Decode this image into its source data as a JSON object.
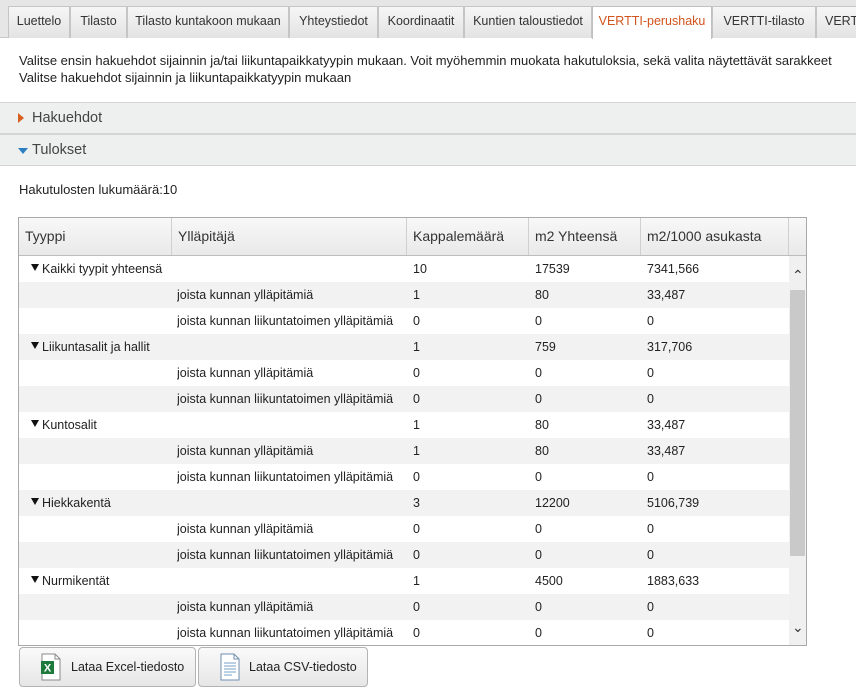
{
  "tabs": [
    {
      "label": "Luettelo",
      "active": false
    },
    {
      "label": "Tilasto",
      "active": false
    },
    {
      "label": "Tilasto kuntakoon mukaan",
      "active": false
    },
    {
      "label": "Yhteystiedot",
      "active": false
    },
    {
      "label": "Koordinaatit",
      "active": false
    },
    {
      "label": "Kuntien taloustiedot",
      "active": false
    },
    {
      "label": "VERTTI-perushaku",
      "active": true
    },
    {
      "label": "VERTTI-tilasto",
      "active": false
    },
    {
      "label": "VERT",
      "active": false
    }
  ],
  "intro": {
    "line1": "Valitse ensin hakuehdot sijainnin ja/tai liikuntapaikkatyypin mukaan. Voit myöhemmin muokata hakutuloksia, sekä valita näytettävät sarakkeet",
    "line2": "Valitse hakuehdot sijainnin ja liikuntapaikkatyypin mukaan"
  },
  "sections": {
    "search": "Hakuehdot",
    "results": "Tulokset"
  },
  "result_count": "Hakutulosten lukumäärä:10",
  "grid": {
    "columns": [
      "Tyyppi",
      "Ylläpitäjä",
      "Kappalemäärä",
      "m2 Yhteensä",
      "m2/1000 asukasta"
    ],
    "rows": [
      {
        "type": "Kaikki tyypit yhteensä",
        "maintainer": "",
        "count": "10",
        "m2": "17539",
        "per1000": "7341,566"
      },
      {
        "type": "",
        "maintainer": "joista kunnan ylläpitämiä",
        "count": "1",
        "m2": "80",
        "per1000": "33,487"
      },
      {
        "type": "",
        "maintainer": "joista kunnan liikuntatoimen ylläpitämiä",
        "count": "0",
        "m2": "0",
        "per1000": "0"
      },
      {
        "type": "Liikuntasalit ja hallit",
        "maintainer": "",
        "count": "1",
        "m2": "759",
        "per1000": "317,706"
      },
      {
        "type": "",
        "maintainer": "joista kunnan ylläpitämiä",
        "count": "0",
        "m2": "0",
        "per1000": "0"
      },
      {
        "type": "",
        "maintainer": "joista kunnan liikuntatoimen ylläpitämiä",
        "count": "0",
        "m2": "0",
        "per1000": "0"
      },
      {
        "type": "Kuntosalit",
        "maintainer": "",
        "count": "1",
        "m2": "80",
        "per1000": "33,487"
      },
      {
        "type": "",
        "maintainer": "joista kunnan ylläpitämiä",
        "count": "1",
        "m2": "80",
        "per1000": "33,487"
      },
      {
        "type": "",
        "maintainer": "joista kunnan liikuntatoimen ylläpitämiä",
        "count": "0",
        "m2": "0",
        "per1000": "0"
      },
      {
        "type": "Hiekkakentä",
        "maintainer": "",
        "count": "3",
        "m2": "12200",
        "per1000": "5106,739"
      },
      {
        "type": "",
        "maintainer": "joista kunnan ylläpitämiä",
        "count": "0",
        "m2": "0",
        "per1000": "0"
      },
      {
        "type": "",
        "maintainer": "joista kunnan liikuntatoimen ylläpitämiä",
        "count": "0",
        "m2": "0",
        "per1000": "0"
      },
      {
        "type": "Nurmikentät",
        "maintainer": "",
        "count": "1",
        "m2": "4500",
        "per1000": "1883,633"
      },
      {
        "type": "",
        "maintainer": "joista kunnan ylläpitämiä",
        "count": "0",
        "m2": "0",
        "per1000": "0"
      },
      {
        "type": "",
        "maintainer": "joista kunnan liikuntatoimen ylläpitämiä",
        "count": "0",
        "m2": "0",
        "per1000": "0"
      }
    ]
  },
  "buttons": {
    "excel": "Lataa Excel-tiedosto",
    "csv": "Lataa CSV-tiedosto"
  },
  "colors": {
    "active_tab_text": "#d2531c",
    "collapsed_arrow": "#d95f1e",
    "expanded_arrow": "#2d7fc1",
    "excel_icon": "#1d7a3c"
  }
}
